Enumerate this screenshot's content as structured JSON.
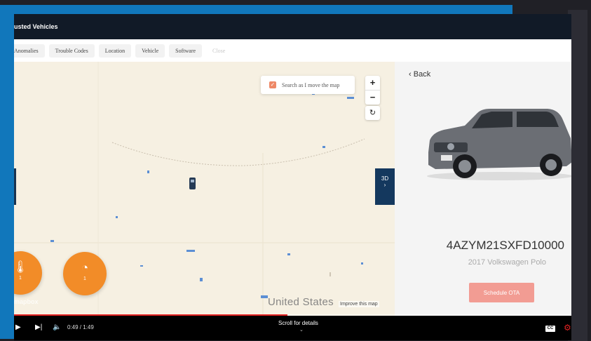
{
  "app": {
    "title": "usted Vehicles"
  },
  "tabs": [
    {
      "label": "Anomalies"
    },
    {
      "label": "Trouble Codes"
    },
    {
      "label": "Location"
    },
    {
      "label": "Vehicle"
    },
    {
      "label": "Software"
    },
    {
      "label": "Close"
    }
  ],
  "map": {
    "search_label": "Search as I move the map",
    "search_checked": true,
    "zoom_in": "+",
    "zoom_out": "−",
    "reset": "↻",
    "toggle_3d": "3D",
    "country_label": "United States",
    "attribution": "Improve this map",
    "logo": "mapbox",
    "badges": [
      {
        "name": "temperature",
        "icon": "thermometer-icon",
        "count": "1"
      },
      {
        "name": "speed",
        "icon": "gauge-icon",
        "count": "1"
      }
    ]
  },
  "panel": {
    "back_label": "Back",
    "vin": "4AZYM21SXFD10000",
    "model": "2017 Volkswagen Polo",
    "schedule_button": "Schedule OTA"
  },
  "player": {
    "time": "0:49 / 1:49",
    "progress": 0.49,
    "scroll_hint": "Scroll for details",
    "cc": "CC"
  },
  "colors": {
    "header": "#111a27",
    "accent_orange": "#f28c28",
    "ota_button": "#f29c93",
    "progress": "#e32222",
    "frame_blue": "#1177bb"
  }
}
